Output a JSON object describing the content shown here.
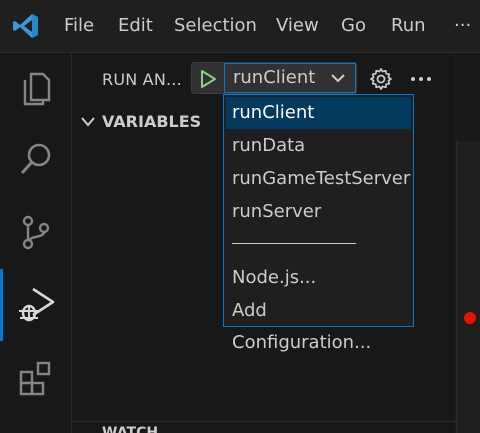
{
  "menubar": {
    "items": [
      "File",
      "Edit",
      "Selection",
      "View",
      "Go",
      "Run",
      "···"
    ]
  },
  "activitybar": {
    "items": [
      "explorer-icon",
      "search-icon",
      "source-control-icon",
      "run-debug-icon",
      "extensions-icon"
    ],
    "active": "run-debug-icon"
  },
  "sidebar": {
    "title": "RUN AN...",
    "selected_config": "runClient",
    "sections": {
      "variables": "VARIABLES",
      "watch": "WATCH"
    }
  },
  "dropdown": {
    "options": [
      "runClient",
      "runData",
      "runGameTestServer",
      "runServer"
    ],
    "extra_options": [
      "Node.js...",
      "Add Configuration..."
    ],
    "selected_index": 0
  },
  "colors": {
    "accent": "#0078d4",
    "play": "#89d185",
    "selected_bg": "#04395e",
    "breakpoint": "#e51400"
  }
}
